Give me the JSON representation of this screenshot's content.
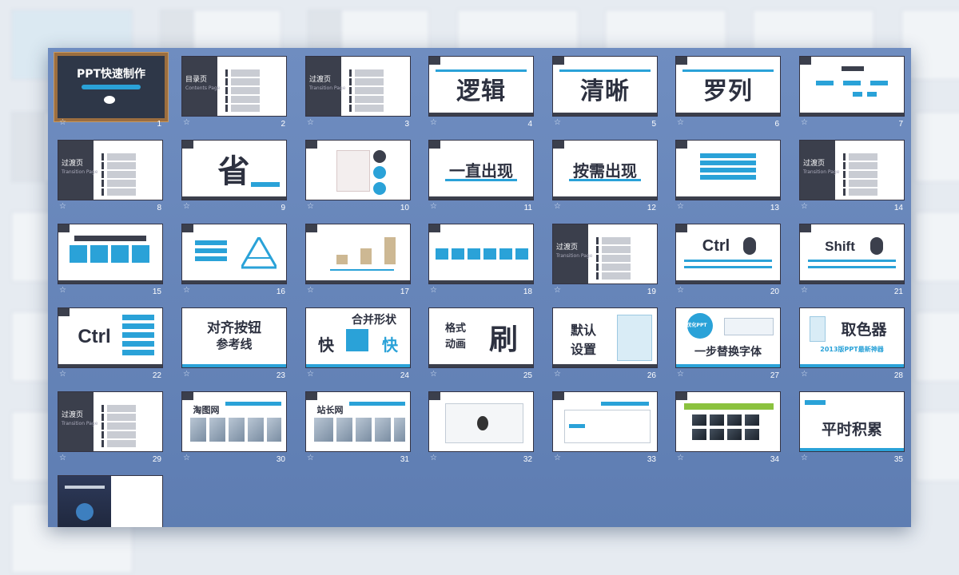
{
  "cover": {
    "title": "PPT快速制作"
  },
  "transition": {
    "title": "过渡页",
    "sub": "Transition Page"
  },
  "contents": {
    "title": "目录页",
    "sub": "Contents Page"
  },
  "slides": {
    "s4": "逻辑",
    "s5": "清晰",
    "s6": "罗列",
    "s9": "省",
    "s11": "一直出现",
    "s12": "按需出现",
    "s20": "Ctrl",
    "s21": "Shift",
    "s22": "Ctrl",
    "s23a": "对齐按钮",
    "s23b": "参考线",
    "s24a": "合并形状",
    "s24b": "快",
    "s24c": "快",
    "s25a": "格式",
    "s25b": "动画",
    "s25c": "刷",
    "s26a": "默认",
    "s26b": "设置",
    "s27a": "优化PPT",
    "s27b": "一步替换字体",
    "s28a": "取色器",
    "s28b": "2013版PPT最新神器",
    "s30": "淘图网",
    "s31": "站长网",
    "s35": "平时积累"
  },
  "numbers": [
    "1",
    "2",
    "3",
    "4",
    "5",
    "6",
    "7",
    "8",
    "9",
    "10",
    "11",
    "12",
    "13",
    "14",
    "15",
    "16",
    "17",
    "18",
    "19",
    "20",
    "21",
    "22",
    "23",
    "24",
    "25",
    "26",
    "27",
    "28",
    "29",
    "30",
    "31",
    "32",
    "33",
    "34",
    "35"
  ],
  "icons": {
    "star": "star-icon",
    "mouse": "mouse-icon"
  },
  "colors": {
    "accent": "#2aa2d8",
    "dark": "#3b3f4c",
    "window": "#6f8dc0",
    "selection": "#9c6e3f"
  }
}
